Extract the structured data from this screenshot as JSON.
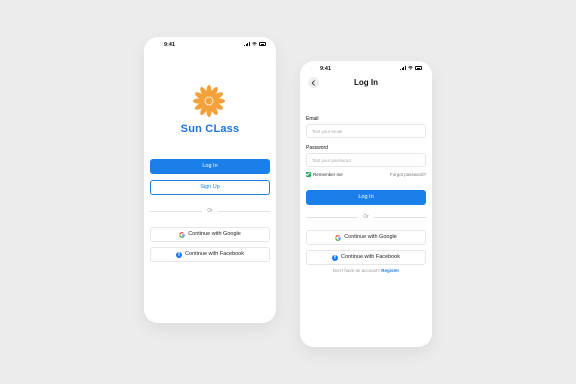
{
  "colors": {
    "primary": "#1a7fe8",
    "brand_text": "#1a73e8",
    "logo": "#f5a13a",
    "checkbox": "#27ae60",
    "facebook": "#1877f2"
  },
  "screen1": {
    "time": "9:41",
    "brand": "Sun CLass",
    "login_label": "Log In",
    "signup_label": "Sign Up",
    "divider": "Or",
    "google_label": "Continue with Google",
    "facebook_label": "Continue with Facebook",
    "icons": [
      "sun-logo-icon",
      "google-icon",
      "facebook-icon"
    ]
  },
  "screen2": {
    "time": "9:41",
    "title": "Log In",
    "email_label": "Email",
    "email_placeholder": "Text your email",
    "password_label": "Password",
    "password_placeholder": "Text your password",
    "remember_label": "Remember me",
    "remember_checked": true,
    "forgot_label": "Forgot password?",
    "login_label": "Log In",
    "divider": "Or",
    "google_label": "Continue with Google",
    "facebook_label": "Continue with Facebook",
    "no_account_text": "Don't have an account?",
    "register_label": "Register",
    "icons": [
      "back-arrow-icon",
      "google-icon",
      "facebook-icon"
    ]
  }
}
